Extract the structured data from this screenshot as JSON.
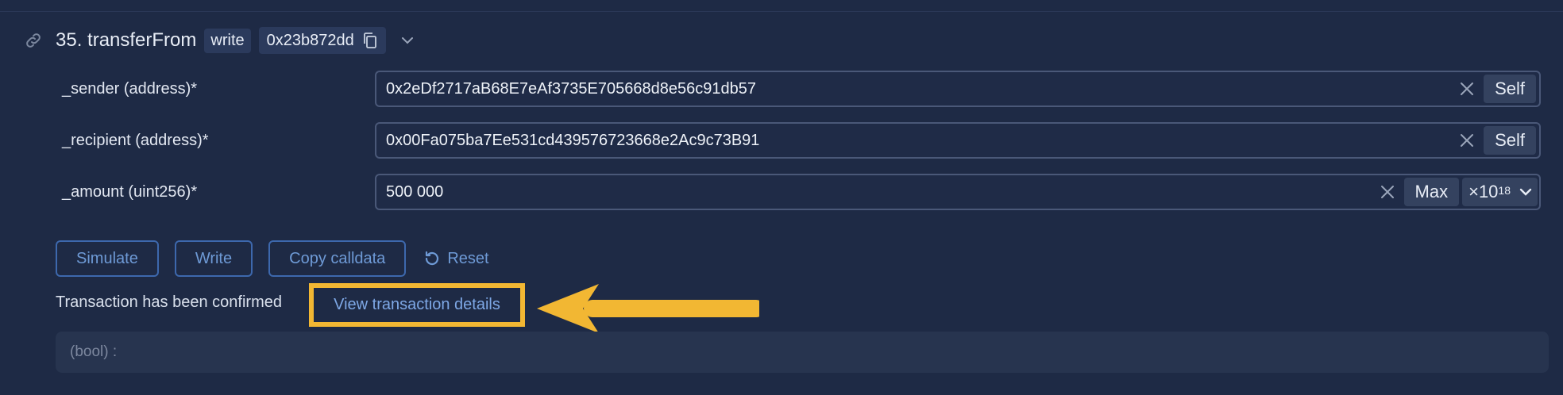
{
  "method": {
    "index_title": "35. transferFrom",
    "type_tag": "write",
    "selector": "0x23b872dd"
  },
  "inputs": [
    {
      "label": "_sender (address)*",
      "value": "0x2eDf2717aB68E7eAf3735E705668d8e56c91db57",
      "action": "Self"
    },
    {
      "label": "_recipient (address)*",
      "value": "0x00Fa075ba7Ee531cd439576723668e2Ac9c73B91",
      "action": "Self"
    },
    {
      "label": "_amount (uint256)*",
      "value": "500 000",
      "action": "Max",
      "unit_base": "×10",
      "unit_exp": "18"
    }
  ],
  "buttons": {
    "simulate": "Simulate",
    "write": "Write",
    "copy_calldata": "Copy calldata",
    "reset": "Reset"
  },
  "status": {
    "message": "Transaction has been confirmed",
    "link": "View transaction details"
  },
  "output": {
    "text": "(bool) :"
  },
  "colors": {
    "background": "#1e2a45",
    "accent": "#6e9ad6",
    "highlight": "#f2b733"
  }
}
